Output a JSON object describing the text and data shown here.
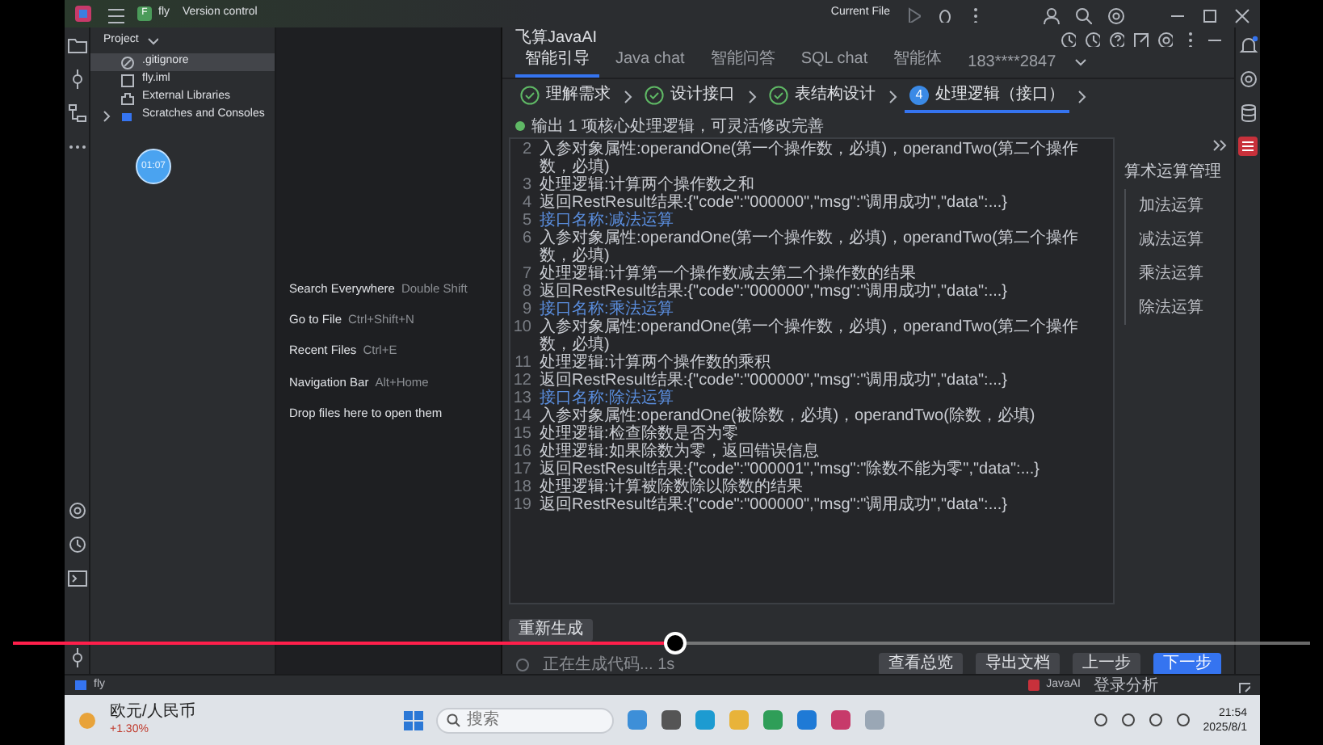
{
  "menu_bar": {
    "project_badge": "F",
    "project": "fly",
    "vcs": "Version control",
    "run_config": "Current File"
  },
  "project_panel": {
    "title": "Project",
    "items": [
      {
        "label": ".gitignore",
        "kind": "ignore",
        "selected": true
      },
      {
        "label": "fly.iml",
        "kind": "module",
        "selected": false
      },
      {
        "label": "External Libraries",
        "kind": "library",
        "selected": false
      },
      {
        "label": "Scratches and Consoles",
        "kind": "scratches",
        "selected": false,
        "expanded": false
      }
    ]
  },
  "video_timestamp": "01:07",
  "editor_hints": [
    {
      "action": "Search Everywhere",
      "shortcut": "Double Shift"
    },
    {
      "action": "Go to File",
      "shortcut": "Ctrl+Shift+N"
    },
    {
      "action": "Recent Files",
      "shortcut": "Ctrl+E"
    },
    {
      "action": "Navigation Bar",
      "shortcut": "Alt+Home"
    },
    {
      "action": "Drop files here to open them"
    }
  ],
  "ai_panel": {
    "title": "飞算JavaAI",
    "tabs": [
      {
        "label": "智能引导",
        "selected": true
      },
      {
        "label": "Java chat",
        "selected": false
      },
      {
        "label": "智能问答",
        "selected": false
      },
      {
        "label": "SQL chat",
        "selected": false
      },
      {
        "label": "智能体",
        "selected": false
      }
    ],
    "account": "183****2847",
    "steps": [
      {
        "label": "理解需求",
        "kind": "done",
        "selected": false
      },
      {
        "label": "设计接口",
        "kind": "done",
        "selected": false
      },
      {
        "label": "表结构设计",
        "kind": "done",
        "selected": false
      },
      {
        "label": "处理逻辑（接口）",
        "kind": "current",
        "number": "4",
        "selected": true
      }
    ],
    "message": "输出 1 项核心处理逻辑，可灵活修改完善",
    "lines": [
      {
        "number": "2",
        "kind": "text",
        "text": "入参对象属性:operandOne(第一个操作数，必填)，operandTwo(第二个操作数，必填)"
      },
      {
        "number": "3",
        "kind": "text",
        "text": "处理逻辑:计算两个操作数之和"
      },
      {
        "number": "4",
        "kind": "text",
        "text": "返回RestResult结果:{\"code\":\"000000\",\"msg\":\"调用成功\",\"data\":...}"
      },
      {
        "number": "5",
        "kind": "heading",
        "text": "接口名称:减法运算"
      },
      {
        "number": "6",
        "kind": "text",
        "text": "入参对象属性:operandOne(第一个操作数，必填)，operandTwo(第二个操作数，必填)"
      },
      {
        "number": "7",
        "kind": "text",
        "text": "处理逻辑:计算第一个操作数减去第二个操作数的结果"
      },
      {
        "number": "8",
        "kind": "text",
        "text": "返回RestResult结果:{\"code\":\"000000\",\"msg\":\"调用成功\",\"data\":...}"
      },
      {
        "number": "9",
        "kind": "heading",
        "text": "接口名称:乘法运算"
      },
      {
        "number": "10",
        "kind": "text",
        "text": "入参对象属性:operandOne(第一个操作数，必填)，operandTwo(第二个操作数，必填)"
      },
      {
        "number": "11",
        "kind": "text",
        "text": "处理逻辑:计算两个操作数的乘积"
      },
      {
        "number": "12",
        "kind": "text",
        "text": "返回RestResult结果:{\"code\":\"000000\",\"msg\":\"调用成功\",\"data\":...}"
      },
      {
        "number": "13",
        "kind": "heading",
        "text": "接口名称:除法运算"
      },
      {
        "number": "14",
        "kind": "text",
        "text": "入参对象属性:operandOne(被除数，必填)，operandTwo(除数，必填)"
      },
      {
        "number": "15",
        "kind": "text",
        "text": "处理逻辑:检查除数是否为零"
      },
      {
        "number": "16",
        "kind": "text",
        "text": "处理逻辑:如果除数为零，返回错误信息"
      },
      {
        "number": "17",
        "kind": "text",
        "text": "返回RestResult结果:{\"code\":\"000001\",\"msg\":\"除数不能为零\",\"data\":...}"
      },
      {
        "number": "18",
        "kind": "text",
        "text": "处理逻辑:计算被除数除以除数的结果"
      },
      {
        "number": "19",
        "kind": "text",
        "text": "返回RestResult结果:{\"code\":\"000000\",\"msg\":\"调用成功\",\"data\":...}"
      }
    ],
    "outline": {
      "title": "算术运算管理",
      "children": [
        {
          "label": "加法运算"
        },
        {
          "label": "减法运算"
        },
        {
          "label": "乘法运算"
        },
        {
          "label": "除法运算"
        }
      ]
    },
    "regenerate": "重新生成",
    "progress_text": "正在生成代码... 1s",
    "buttons": [
      {
        "label": "查看总览",
        "kind": "secondary"
      },
      {
        "label": "导出文档",
        "kind": "secondary"
      },
      {
        "label": "上一步",
        "kind": "secondary"
      },
      {
        "label": "下一步",
        "kind": "primary"
      }
    ]
  },
  "status_bar": {
    "project": "fly",
    "plugin": "JavaAI",
    "plugin_status": "登录分析"
  },
  "taskbar": {
    "widget_title": "欧元/人民币",
    "widget_change": "+1.30%",
    "search_placeholder": "搜索",
    "time": "21:54",
    "date": "2025/8/1"
  },
  "video": {
    "level": 0.51
  }
}
